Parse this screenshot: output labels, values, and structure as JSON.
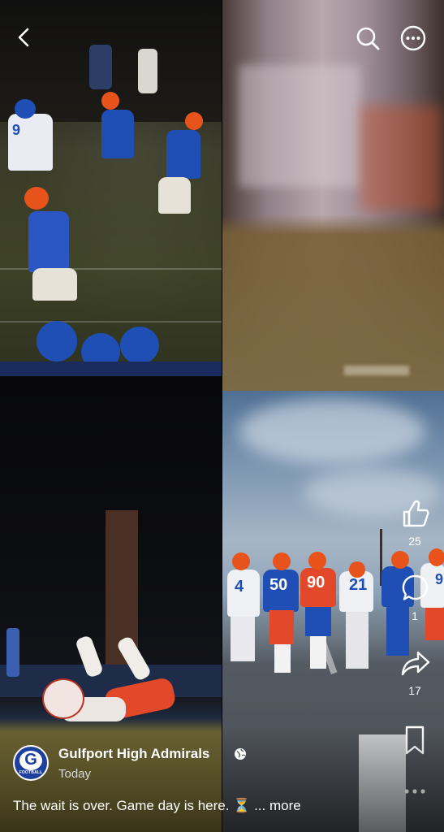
{
  "post": {
    "author": "Gulfport High Admirals",
    "time": "Today",
    "caption": "The wait is over.  Game day is here. ⏳",
    "more_label": "... more",
    "avatar_letter": "G",
    "avatar_sub": "FOOTBALL"
  },
  "actions": {
    "like_count": "25",
    "comment_count": "1",
    "share_count": "17"
  },
  "icons": {
    "back": "chevron-left-icon",
    "search": "search-icon",
    "more": "more-horizontal-icon",
    "like": "thumbs-up-icon",
    "comment": "comment-icon",
    "share": "share-icon",
    "bookmark": "bookmark-icon",
    "overflow": "more-horizontal-icon",
    "audience": "globe-icon"
  },
  "players_br": [
    {
      "number": "4"
    },
    {
      "number": "50"
    },
    {
      "number": "90"
    },
    {
      "number": "21"
    },
    {
      "number": "9"
    }
  ],
  "players_tl": [
    {
      "number": "9"
    }
  ],
  "colors": {
    "team_blue": "#1f4fb5",
    "team_orange": "#e8531b",
    "avatar_blue": "#1d3f9e"
  }
}
